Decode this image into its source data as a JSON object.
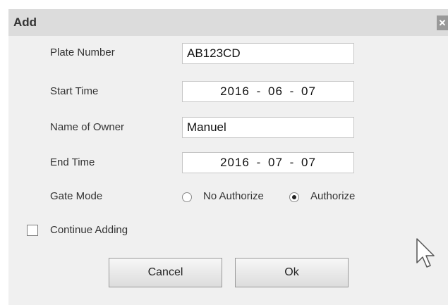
{
  "dialog": {
    "title": "Add",
    "close_icon": "close-icon"
  },
  "form": {
    "plate_number": {
      "label": "Plate Number",
      "value": "AB123CD"
    },
    "start_time": {
      "label": "Start Time",
      "value": "2016 - 06 - 07"
    },
    "name_of_owner": {
      "label": "Name of Owner",
      "value": "Manuel"
    },
    "end_time": {
      "label": "End Time",
      "value": "2016 - 07 - 07"
    },
    "gate_mode": {
      "label": "Gate Mode",
      "options": [
        {
          "label": "No Authorize",
          "selected": false
        },
        {
          "label": "Authorize",
          "selected": true
        }
      ]
    },
    "continue_adding": {
      "label": "Continue Adding",
      "checked": false
    }
  },
  "buttons": {
    "cancel": "Cancel",
    "ok": "Ok"
  },
  "cursor_icon": "mouse-pointer-icon"
}
